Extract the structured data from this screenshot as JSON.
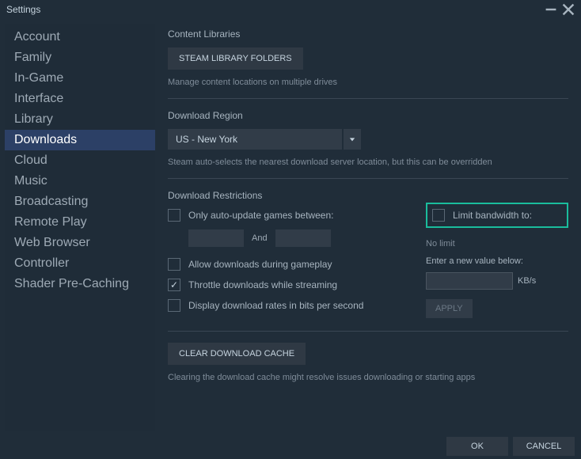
{
  "window": {
    "title": "Settings"
  },
  "sidebar": {
    "items": [
      {
        "label": "Account"
      },
      {
        "label": "Family"
      },
      {
        "label": "In-Game"
      },
      {
        "label": "Interface"
      },
      {
        "label": "Library"
      },
      {
        "label": "Downloads"
      },
      {
        "label": "Cloud"
      },
      {
        "label": "Music"
      },
      {
        "label": "Broadcasting"
      },
      {
        "label": "Remote Play"
      },
      {
        "label": "Web Browser"
      },
      {
        "label": "Controller"
      },
      {
        "label": "Shader Pre-Caching"
      }
    ],
    "active_index": 5
  },
  "content_libraries": {
    "heading": "Content Libraries",
    "button": "STEAM LIBRARY FOLDERS",
    "desc": "Manage content locations on multiple drives"
  },
  "download_region": {
    "heading": "Download Region",
    "selected": "US - New York",
    "desc": "Steam auto-selects the nearest download server location, but this can be overridden"
  },
  "restrictions": {
    "heading": "Download Restrictions",
    "only_auto_update": "Only auto-update games between:",
    "and": "And",
    "allow_gameplay": "Allow downloads during gameplay",
    "throttle_streaming": "Throttle downloads while streaming",
    "bits_per_second": "Display download rates in bits per second",
    "limit_bandwidth": "Limit bandwidth to:",
    "no_limit": "No limit",
    "enter_value": "Enter a new value below:",
    "unit": "KB/s",
    "apply": "APPLY"
  },
  "cache": {
    "button": "CLEAR DOWNLOAD CACHE",
    "desc": "Clearing the download cache might resolve issues downloading or starting apps"
  },
  "footer": {
    "ok": "OK",
    "cancel": "CANCEL"
  }
}
